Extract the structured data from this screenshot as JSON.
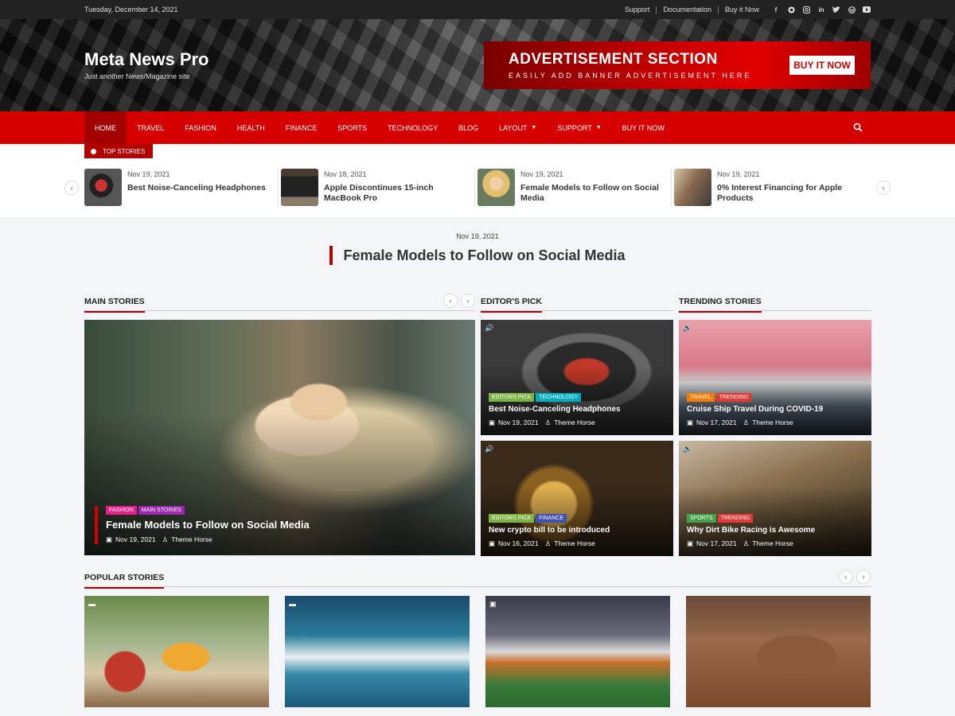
{
  "topbar": {
    "date": "Tuesday, December 14, 2021",
    "links": [
      "Support",
      "Documentation",
      "Buy it Now"
    ],
    "socials": [
      "facebook-icon",
      "github-icon",
      "instagram-icon",
      "linkedin-icon",
      "twitter-icon",
      "wordpress-icon",
      "youtube-icon"
    ]
  },
  "header": {
    "site_title": "Meta News Pro",
    "tagline": "Just another News/Magazine site",
    "ad": {
      "title": "ADVERTISEMENT SECTION",
      "subtitle": "EASILY ADD BANNER ADVERTISEMENT HERE",
      "button": "BUY IT NOW"
    }
  },
  "nav": {
    "items": [
      {
        "label": "HOME",
        "active": true
      },
      {
        "label": "TRAVEL"
      },
      {
        "label": "FASHION"
      },
      {
        "label": "HEALTH"
      },
      {
        "label": "FINANCE"
      },
      {
        "label": "SPORTS"
      },
      {
        "label": "TECHNOLOGY"
      },
      {
        "label": "BLOG"
      },
      {
        "label": "LAYOUT",
        "dropdown": true
      },
      {
        "label": "SUPPORT",
        "dropdown": true
      },
      {
        "label": "BUY IT NOW"
      }
    ]
  },
  "top_stories": {
    "label": "TOP STORIES",
    "items": [
      {
        "date": "Nov 19, 2021",
        "title": "Best Noise-Canceling Headphones"
      },
      {
        "date": "Nov 18, 2021",
        "title": "Apple Discontinues 15-inch MacBook Pro"
      },
      {
        "date": "Nov 19, 2021",
        "title": "Female Models to Follow on Social Media"
      },
      {
        "date": "Nov 19, 2021",
        "title": "0% Interest Financing for Apple Products"
      }
    ]
  },
  "featured": {
    "date": "Nov 19, 2021",
    "title": "Female Models to Follow on Social Media"
  },
  "main_stories": {
    "heading": "MAIN STORIES",
    "card": {
      "badges": [
        "FASHION",
        "MAIN STORIES"
      ],
      "title": "Female Models to Follow on Social Media",
      "date": "Nov 19, 2021",
      "author": "Theme Horse"
    }
  },
  "editors_pick": {
    "heading": "EDITOR'S PICK",
    "cards": [
      {
        "badges": [
          "EDITORS PICK",
          "TECHNOLOGY"
        ],
        "title": "Best Noise-Canceling Headphones",
        "date": "Nov 19, 2021",
        "author": "Theme Horse"
      },
      {
        "badges": [
          "EDITORS PICK",
          "FINANCE"
        ],
        "title": "New crypto bill to be introduced",
        "date": "Nov 16, 2021",
        "author": "Theme Horse"
      }
    ]
  },
  "trending": {
    "heading": "TRENDING STORIES",
    "cards": [
      {
        "badges": [
          "TRAVEL",
          "TRENDING"
        ],
        "title": "Cruise Ship Travel During COVID-19",
        "date": "Nov 17, 2021",
        "author": "Theme Horse"
      },
      {
        "badges": [
          "SPORTS",
          "TRENDING"
        ],
        "title": "Why Dirt Bike Racing is Awesome",
        "date": "Nov 17, 2021",
        "author": "Theme Horse"
      }
    ]
  },
  "popular": {
    "heading": "POPULAR STORIES"
  },
  "colors": {
    "brand_red": "#d60000",
    "dark_red": "#a30000",
    "badge_fashion": "#e91e8c",
    "badge_main": "#9c27b0",
    "badge_editors": "#7cb342",
    "badge_technology": "#00acc1",
    "badge_finance": "#3f51b5",
    "badge_travel": "#f57c00",
    "badge_trending": "#e53935",
    "badge_sports": "#43a047"
  }
}
